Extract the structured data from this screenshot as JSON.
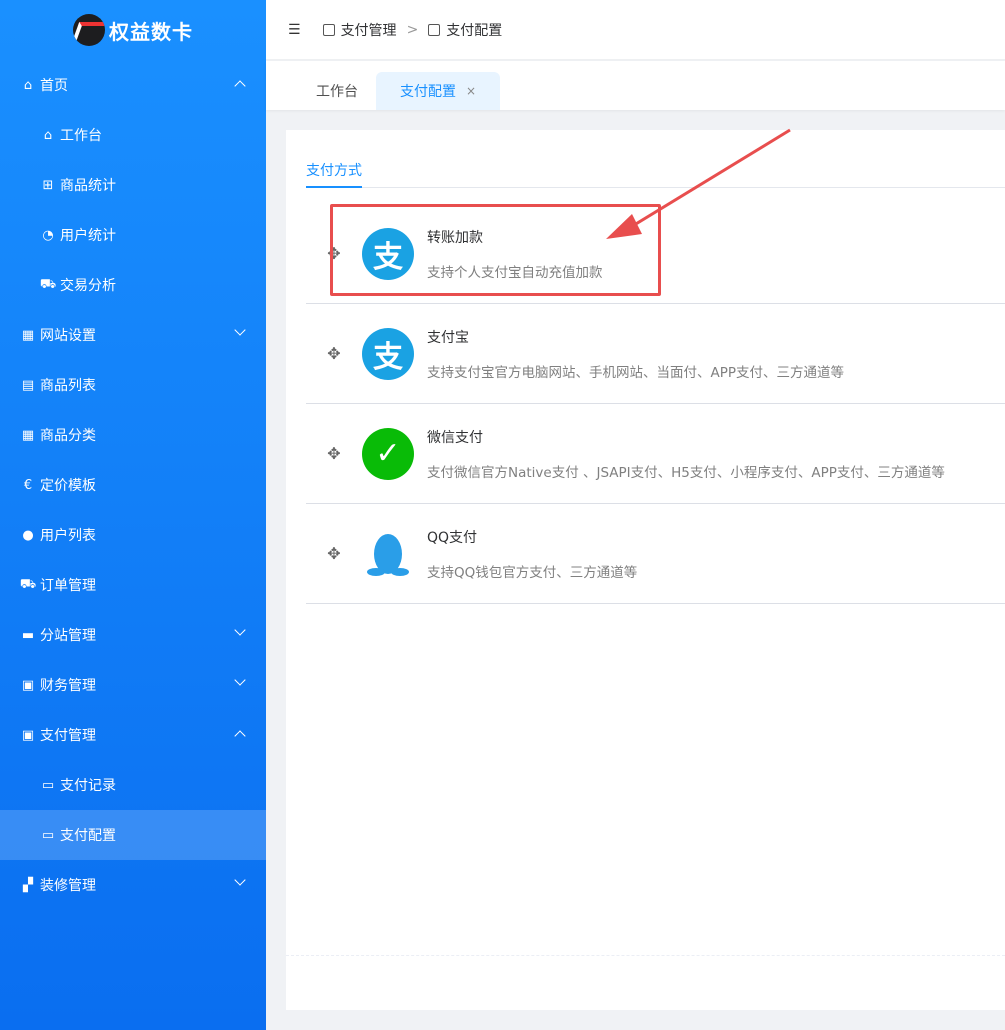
{
  "app": {
    "name": "权益数卡"
  },
  "sidebar": {
    "items": [
      {
        "label": "首页",
        "icon": "home-icon",
        "glyph": "⌂",
        "expand": "up"
      },
      {
        "label": "工作台",
        "icon": "home-icon",
        "glyph": "⌂",
        "sub": true
      },
      {
        "label": "商品统计",
        "icon": "basket-icon",
        "glyph": "⊞",
        "sub": true
      },
      {
        "label": "用户统计",
        "icon": "pie-chart-icon",
        "glyph": "◔",
        "sub": true
      },
      {
        "label": "交易分析",
        "icon": "cart-icon",
        "glyph": "⛟",
        "sub": true
      },
      {
        "label": "网站设置",
        "icon": "building-icon",
        "glyph": "▦",
        "expand": "down"
      },
      {
        "label": "商品列表",
        "icon": "list-icon",
        "glyph": "▤"
      },
      {
        "label": "商品分类",
        "icon": "grid-icon",
        "glyph": "▦"
      },
      {
        "label": "定价模板",
        "icon": "euro-icon",
        "glyph": "€"
      },
      {
        "label": "用户列表",
        "icon": "user-icon",
        "glyph": "●"
      },
      {
        "label": "订单管理",
        "icon": "cart-icon",
        "glyph": "⛟"
      },
      {
        "label": "分站管理",
        "icon": "store-icon",
        "glyph": "▬",
        "expand": "down"
      },
      {
        "label": "财务管理",
        "icon": "money-icon",
        "glyph": "▣",
        "expand": "down"
      },
      {
        "label": "支付管理",
        "icon": "payment-icon",
        "glyph": "▣",
        "expand": "up"
      },
      {
        "label": "支付记录",
        "icon": "book-icon",
        "glyph": "▭",
        "sub": true
      },
      {
        "label": "支付配置",
        "icon": "book-icon",
        "glyph": "▭",
        "sub": true,
        "active": true
      },
      {
        "label": "装修管理",
        "icon": "paint-roller-icon",
        "glyph": "▞",
        "expand": "down"
      }
    ]
  },
  "header": {
    "collapse_glyph": "☰",
    "breadcrumb": [
      "支付管理",
      "支付配置"
    ],
    "separator": ">"
  },
  "tabs": [
    {
      "label": "工作台"
    },
    {
      "label": "支付配置",
      "close": "×"
    }
  ],
  "content": {
    "subtab": "支付方式",
    "drag_glyph": "✥",
    "methods": [
      {
        "name": "转账加款",
        "desc": "支持个人支付宝自动充值加款",
        "icon": "alipay-icon",
        "glyph": "支"
      },
      {
        "name": "支付宝",
        "desc": "支持支付宝官方电脑网站、手机网站、当面付、APP支付、三方通道等",
        "icon": "alipay-icon",
        "glyph": "支"
      },
      {
        "name": "微信支付",
        "desc": "支付微信官方Native支付 、JSAPI支付、H5支付、小程序支付、APP支付、三方通道等",
        "icon": "wechat-pay-icon",
        "glyph": "✓"
      },
      {
        "name": "QQ支付",
        "desc": "支持QQ钱包官方支付、三方通道等",
        "icon": "qq-icon",
        "glyph": ""
      }
    ]
  },
  "colors": {
    "accent": "#1890ff",
    "sidebar": "#0a6ef0",
    "annotation": "#e84e4e"
  }
}
